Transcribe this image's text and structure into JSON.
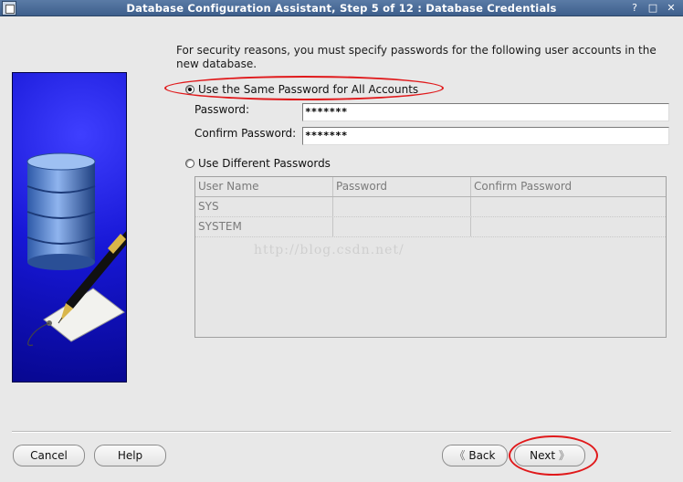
{
  "window": {
    "title": "Database Configuration Assistant, Step 5 of 12 : Database Credentials",
    "controls": [
      "?",
      "□",
      "✕"
    ]
  },
  "intro_text": "For security reasons, you must specify passwords for the following user accounts in the new database.",
  "same_password": {
    "label": "Use the Same Password for All Accounts",
    "selected": true,
    "password_label": "Password:",
    "password_value": "*******",
    "confirm_label": "Confirm Password:",
    "confirm_value": "*******"
  },
  "different_passwords": {
    "label": "Use Different Passwords",
    "selected": false
  },
  "table": {
    "columns": [
      "User Name",
      "Password",
      "Confirm Password"
    ],
    "rows": [
      [
        "SYS",
        "",
        ""
      ],
      [
        "SYSTEM",
        "",
        ""
      ]
    ]
  },
  "watermark": "http://blog.csdn.net/",
  "buttons": {
    "cancel": "Cancel",
    "help": "Help",
    "back": "Back",
    "next": "Next",
    "back_glyph": "《",
    "next_glyph": "》"
  },
  "colors": {
    "titlebar": "#4a6b96",
    "banner": "#1a1acc",
    "annotation": "#e0191b"
  }
}
